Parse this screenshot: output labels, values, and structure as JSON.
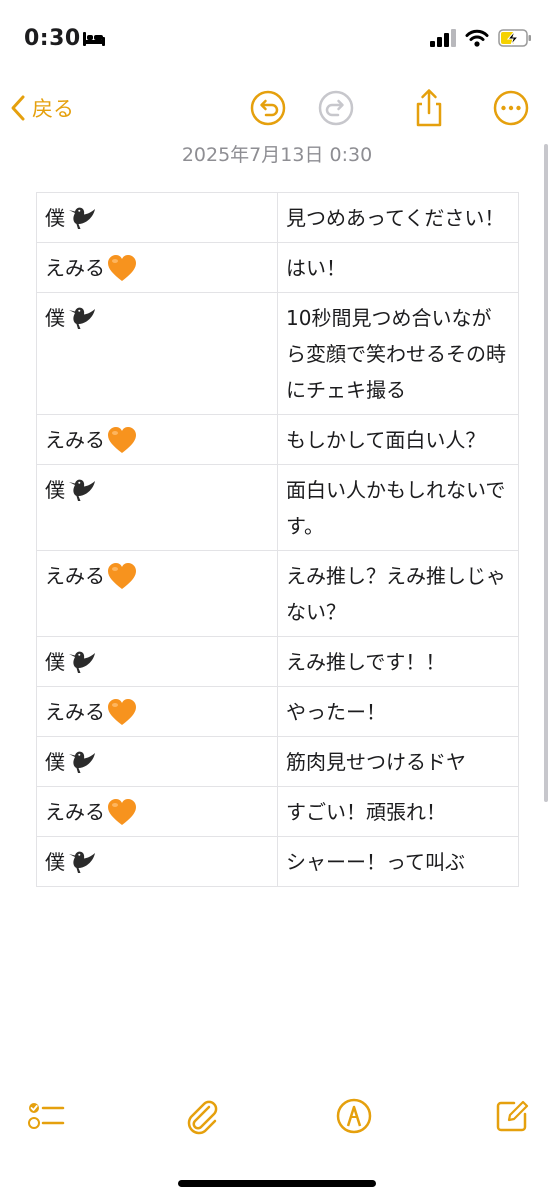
{
  "status_bar": {
    "time": "0:30",
    "battery_state": "charging"
  },
  "nav": {
    "back_label": "戻る"
  },
  "note": {
    "date": "2025年7月13日 0:30"
  },
  "table": {
    "rows": [
      {
        "speaker": "僕",
        "speaker_icon": "black-bird",
        "text": "見つめあってください！"
      },
      {
        "speaker": "えみる",
        "speaker_icon": "orange-heart",
        "text": "はい！"
      },
      {
        "speaker": "僕",
        "speaker_icon": "black-bird",
        "text": "10秒間見つめ合いながら変顔で笑わせるその時にチェキ撮る"
      },
      {
        "speaker": "えみる",
        "speaker_icon": "orange-heart",
        "text": "もしかして面白い人？"
      },
      {
        "speaker": "僕",
        "speaker_icon": "black-bird",
        "text": "面白い人かもしれないです。"
      },
      {
        "speaker": "えみる",
        "speaker_icon": "orange-heart",
        "text": "えみ推し？えみ推しじゃない？"
      },
      {
        "speaker": "僕",
        "speaker_icon": "black-bird",
        "text": "えみ推しです！！"
      },
      {
        "speaker": "えみる",
        "speaker_icon": "orange-heart",
        "text": "やったー！"
      },
      {
        "speaker": "僕",
        "speaker_icon": "black-bird",
        "text": "筋肉見せつけるドヤ"
      },
      {
        "speaker": "えみる",
        "speaker_icon": "orange-heart",
        "text": "すごい！頑張れ！"
      },
      {
        "speaker": "僕",
        "speaker_icon": "black-bird",
        "text": "シャーー！って叫ぶ"
      }
    ]
  },
  "colors": {
    "accent": "#e5a00d",
    "heart": "#f7931e",
    "bird": "#2b2b2b",
    "date_text": "#8e8e93",
    "disabled": "#c7c7cc"
  },
  "icons": {
    "back": "chevron-left-icon",
    "undo": "undo-icon",
    "redo": "redo-icon",
    "share": "share-icon",
    "more": "ellipsis-circle-icon",
    "checklist": "checklist-icon",
    "attach": "paperclip-icon",
    "markup": "markup-pen-icon",
    "compose": "compose-icon"
  }
}
